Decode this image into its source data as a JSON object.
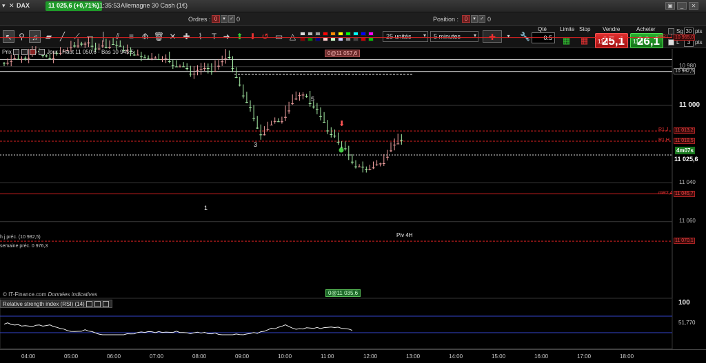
{
  "titlebar": {
    "instrument": "DAX",
    "price_change": "11 025,6 (+0,71%)",
    "time": "11:35:53",
    "name": "Allemagne 30 Cash (1€)"
  },
  "orders": {
    "orders_label": "Ordres :",
    "orders_count": "0",
    "position_label": "Position :",
    "position_count": "0"
  },
  "toolbar": {
    "units_select": "25 unités",
    "period_select": "5 minutes",
    "qty_label": "Qté",
    "qty_value": "0.5",
    "limit_label": "Limite",
    "stop_label": "Stop",
    "sell_label": "Vendre",
    "sell_prefix": "11 0",
    "sell_big": "25,1",
    "buy_label": "Acheter",
    "buy_prefix": "11 0",
    "buy_big": "26,1",
    "sg_label": "Sg",
    "sg_value": "30",
    "pts1": "pts",
    "l_label": "L",
    "l_value": "3",
    "pts2": "pts"
  },
  "chart": {
    "header": "Prix",
    "header_info": "Jour : Haut 11 050,6 - Bas 10 945,5",
    "top_badge": "0@11 057,6",
    "bottom_badge": "0@11 035,6",
    "piv_label": "Piv 4H",
    "left_label1": "h j préc. (10 982,5)",
    "left_label2": "semaine préc. 0 976,3",
    "wave_labels": [
      "1",
      "3",
      "5"
    ],
    "countdown": "4m07s",
    "current_price": "11 025,6",
    "watermark": "© IT-Finance.com",
    "watermark_italic": "Données indicatives",
    "price_axis": [
      "11 060",
      "11 040",
      "11 000",
      "10 980"
    ],
    "levels": [
      {
        "label": "",
        "value": "11 070,1",
        "color": "#d22"
      },
      {
        "label": "mR2,4",
        "value": "11 045,7",
        "color": "#d22"
      },
      {
        "label": "R1,H",
        "value": "11 018,5",
        "color": "#d22"
      },
      {
        "label": "R1,J",
        "value": "11 013,2",
        "color": "#d22"
      },
      {
        "label": "",
        "value": "10 982,5",
        "color": "#eee"
      },
      {
        "label": "mR1,J",
        "value": "10 965,0",
        "color": "#d22"
      }
    ],
    "colors": {
      "up": "#a8f0a8",
      "down": "#f0a0a0",
      "resistance": "#dd2222"
    }
  },
  "rsi": {
    "title": "Relative strength index (RSI) (14)",
    "axis_top": "100",
    "value": "51,770"
  },
  "time_axis": [
    "04:00",
    "05:00",
    "06:00",
    "07:00",
    "08:00",
    "09:00",
    "10:00",
    "11:00",
    "12:00",
    "13:00",
    "14:00",
    "15:00",
    "16:00",
    "17:00",
    "18:00"
  ]
}
